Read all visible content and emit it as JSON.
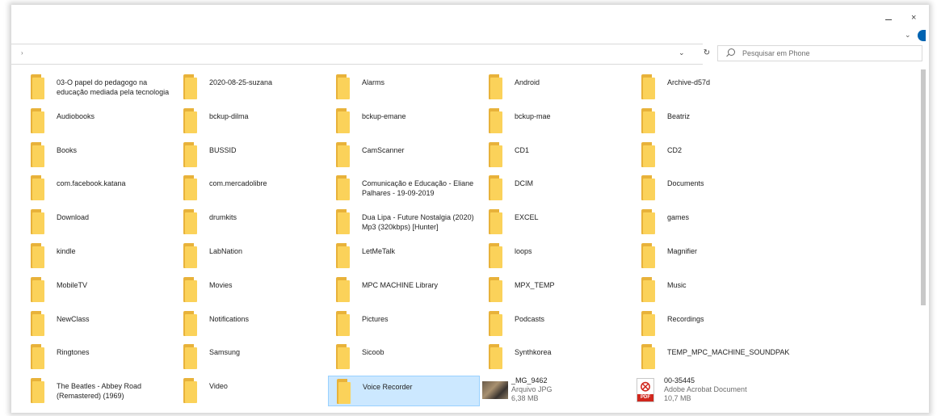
{
  "search": {
    "placeholder": "Pesquisar em Phone"
  },
  "toolbar": {
    "refresh_symbol": "↻",
    "dropdown_symbol": "⌄",
    "address_chevron": "›"
  },
  "window": {
    "close_symbol": "×",
    "collapse_symbol": "⌄"
  },
  "items": [
    {
      "label": "03-O papel do pedagogo na educação mediada pela tecnologia"
    },
    {
      "label": "2020-08-25-suzana"
    },
    {
      "label": "Alarms"
    },
    {
      "label": "Android"
    },
    {
      "label": "Archive-d57d"
    },
    {
      "label": "Audiobooks"
    },
    {
      "label": "bckup-dilma"
    },
    {
      "label": "bckup-emane"
    },
    {
      "label": "bckup-mae"
    },
    {
      "label": "Beatriz"
    },
    {
      "label": "Books"
    },
    {
      "label": "BUSSID"
    },
    {
      "label": "CamScanner"
    },
    {
      "label": "CD1"
    },
    {
      "label": "CD2"
    },
    {
      "label": "com.facebook.katana"
    },
    {
      "label": "com.mercadolibre"
    },
    {
      "label": "Comunicação e Educação - Eliane Palhares - 19-09-2019"
    },
    {
      "label": "DCIM"
    },
    {
      "label": "Documents"
    },
    {
      "label": "Download"
    },
    {
      "label": "drumkits"
    },
    {
      "label": "Dua Lipa - Future Nostalgia (2020) Mp3 (320kbps) [Hunter]"
    },
    {
      "label": "EXCEL"
    },
    {
      "label": "games"
    },
    {
      "label": "kindle"
    },
    {
      "label": "LabNation"
    },
    {
      "label": "LetMeTalk"
    },
    {
      "label": "loops"
    },
    {
      "label": "Magnifier"
    },
    {
      "label": "MobileTV"
    },
    {
      "label": "Movies"
    },
    {
      "label": "MPC MACHINE Library"
    },
    {
      "label": "MPX_TEMP"
    },
    {
      "label": "Music"
    },
    {
      "label": "NewClass"
    },
    {
      "label": "Notifications"
    },
    {
      "label": "Pictures"
    },
    {
      "label": "Podcasts"
    },
    {
      "label": "Recordings"
    },
    {
      "label": "Ringtones"
    },
    {
      "label": "Samsung"
    },
    {
      "label": "Sicoob"
    },
    {
      "label": "Synthkorea"
    },
    {
      "label": "TEMP_MPC_MACHINE_SOUNDPAK"
    },
    {
      "label": "The Beatles - Abbey Road (Remastered) (1969)"
    },
    {
      "label": "Video"
    },
    {
      "label": "Voice Recorder"
    }
  ],
  "files": [
    {
      "name": "_MG_9462",
      "type": "Arquivo JPG",
      "size": "6,38 MB"
    },
    {
      "name": "00-35445",
      "type": "Adobe Acrobat Document",
      "size": "10,7 MB",
      "icon_tag": "PDF"
    }
  ]
}
